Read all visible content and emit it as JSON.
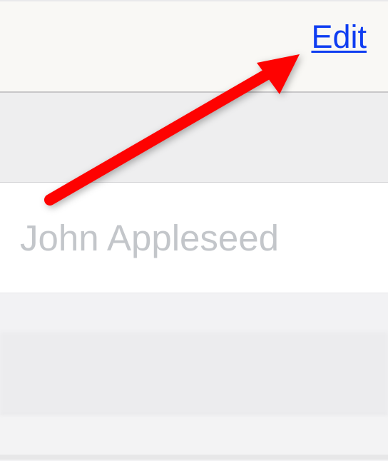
{
  "nav": {
    "edit_label": "Edit"
  },
  "name_field": {
    "placeholder": "John Appleseed",
    "value": ""
  },
  "annotation": {
    "arrow_color": "#fe0201"
  }
}
